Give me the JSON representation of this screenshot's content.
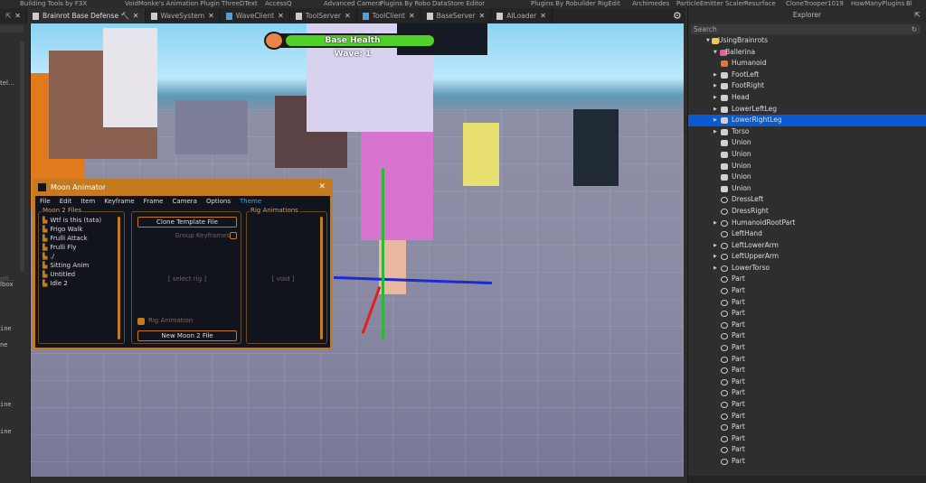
{
  "plugins": [
    "Building Tools by F3X",
    "VoidMonke's Animation Plugin",
    "ThreeDText",
    "AccessQ",
    "Advanced Camera",
    "Plugins By Robo",
    "DataStore Editor",
    "Plugins By Robuilder",
    "RigEdit",
    "Archimedes",
    "ParticleEmitter Scaler",
    "Resurface",
    "CloneTrooper1019",
    "HowManyPlugins",
    "Bl"
  ],
  "tabs": [
    {
      "label": "Brainrot Base Defense 🔨",
      "active": true
    },
    {
      "label": "WaveSystem"
    },
    {
      "label": "WaveClient"
    },
    {
      "label": "ToolServer"
    },
    {
      "label": "ToolClient"
    },
    {
      "label": "BaseServer"
    },
    {
      "label": "AILoader"
    }
  ],
  "left_panel": {
    "truncated": [
      "tel…",
      "ott…",
      "lbox",
      "ine",
      "ne",
      "ine",
      "ine"
    ]
  },
  "hud": {
    "health_label": "Base Health",
    "wave": "Wave: 1",
    "health_color": "#4fd12a"
  },
  "moon": {
    "title": "Moon Animator",
    "close": "✕",
    "menu": [
      "File",
      "Edit",
      "Item",
      "Keyframe",
      "Frame",
      "Camera",
      "Options",
      "Theme"
    ],
    "files_label": "Moon 2 Files",
    "files": [
      "Wtf is this (tata)",
      "Frigo Walk",
      "Frulli Attack",
      "Frulli Fly",
      "./",
      "Sitting Anim",
      "Untitled",
      "Idle 2"
    ],
    "clone_btn": "Clone Template File",
    "group_keyframes": "Group Keyframes",
    "select_rig": "[   select rig   ]",
    "rig_animation": "Rig Animation",
    "new_file_btn": "New Moon 2 File",
    "rig_anims_label": "Rig Animations",
    "void": "[   void   ]",
    "accent": "#c47a1e"
  },
  "explorer": {
    "title": "Explorer",
    "search_placeholder": "Search",
    "items": [
      {
        "label": "UsingBrainrots",
        "level": 0,
        "arrow": "▼",
        "icon": "folder"
      },
      {
        "label": "Ballerina",
        "level": 1,
        "arrow": "▼",
        "icon": "model"
      },
      {
        "label": "Humanoid",
        "level": 2,
        "arrow": "",
        "icon": "humanoid"
      },
      {
        "label": "FootLeft",
        "level": 2,
        "arrow": "▶",
        "icon": "union"
      },
      {
        "label": "FootRight",
        "level": 2,
        "arrow": "▶",
        "icon": "union"
      },
      {
        "label": "Head",
        "level": 2,
        "arrow": "▶",
        "icon": "union"
      },
      {
        "label": "LowerLeftLeg",
        "level": 2,
        "arrow": "▶",
        "icon": "union"
      },
      {
        "label": "LowerRightLeg",
        "level": 2,
        "arrow": "▶",
        "icon": "union",
        "selected": true
      },
      {
        "label": "Torso",
        "level": 2,
        "arrow": "▶",
        "icon": "union"
      },
      {
        "label": "Union",
        "level": 2,
        "arrow": "",
        "icon": "union"
      },
      {
        "label": "Union",
        "level": 2,
        "arrow": "",
        "icon": "union"
      },
      {
        "label": "Union",
        "level": 2,
        "arrow": "",
        "icon": "union"
      },
      {
        "label": "Union",
        "level": 2,
        "arrow": "",
        "icon": "union"
      },
      {
        "label": "Union",
        "level": 2,
        "arrow": "",
        "icon": "union"
      },
      {
        "label": "DressLeft",
        "level": 2,
        "arrow": "",
        "icon": "part"
      },
      {
        "label": "DressRight",
        "level": 2,
        "arrow": "",
        "icon": "part"
      },
      {
        "label": "HumanoidRootPart",
        "level": 2,
        "arrow": "▶",
        "icon": "part"
      },
      {
        "label": "LeftHand",
        "level": 2,
        "arrow": "",
        "icon": "part"
      },
      {
        "label": "LeftLowerArm",
        "level": 2,
        "arrow": "▶",
        "icon": "part"
      },
      {
        "label": "LeftUpperArm",
        "level": 2,
        "arrow": "▶",
        "icon": "part"
      },
      {
        "label": "LowerTorso",
        "level": 2,
        "arrow": "▶",
        "icon": "part"
      },
      {
        "label": "Part",
        "level": 2,
        "arrow": "",
        "icon": "part"
      },
      {
        "label": "Part",
        "level": 2,
        "arrow": "",
        "icon": "part"
      },
      {
        "label": "Part",
        "level": 2,
        "arrow": "",
        "icon": "part"
      },
      {
        "label": "Part",
        "level": 2,
        "arrow": "",
        "icon": "part"
      },
      {
        "label": "Part",
        "level": 2,
        "arrow": "",
        "icon": "part"
      },
      {
        "label": "Part",
        "level": 2,
        "arrow": "",
        "icon": "part"
      },
      {
        "label": "Part",
        "level": 2,
        "arrow": "",
        "icon": "part"
      },
      {
        "label": "Part",
        "level": 2,
        "arrow": "",
        "icon": "part"
      },
      {
        "label": "Part",
        "level": 2,
        "arrow": "",
        "icon": "part"
      },
      {
        "label": "Part",
        "level": 2,
        "arrow": "",
        "icon": "part"
      },
      {
        "label": "Part",
        "level": 2,
        "arrow": "",
        "icon": "part"
      },
      {
        "label": "Part",
        "level": 2,
        "arrow": "",
        "icon": "part"
      },
      {
        "label": "Part",
        "level": 2,
        "arrow": "",
        "icon": "part"
      },
      {
        "label": "Part",
        "level": 2,
        "arrow": "",
        "icon": "part"
      },
      {
        "label": "Part",
        "level": 2,
        "arrow": "",
        "icon": "part"
      },
      {
        "label": "Part",
        "level": 2,
        "arrow": "",
        "icon": "part"
      },
      {
        "label": "Part",
        "level": 2,
        "arrow": "",
        "icon": "part"
      }
    ]
  }
}
